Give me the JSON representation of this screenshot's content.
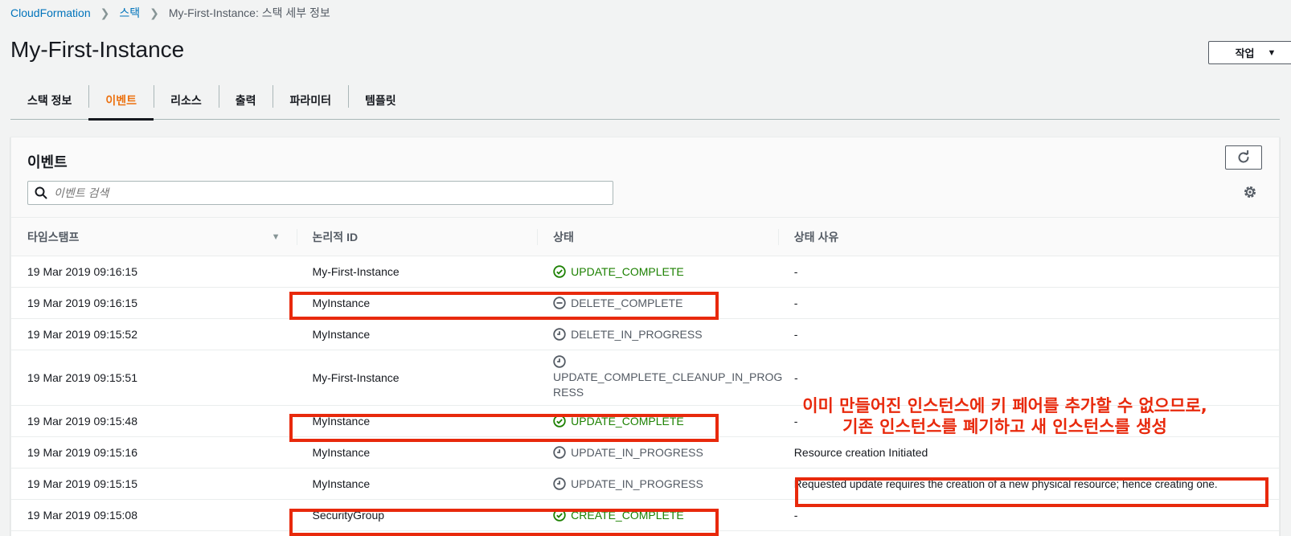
{
  "breadcrumb": {
    "items": [
      "CloudFormation",
      "스택"
    ],
    "current": "My-First-Instance: 스택 세부 정보"
  },
  "page_title": "My-First-Instance",
  "actions_label": "작업",
  "tabs": [
    {
      "label": "스택 정보"
    },
    {
      "label": "이벤트",
      "active": true
    },
    {
      "label": "리소스"
    },
    {
      "label": "출력"
    },
    {
      "label": "파라미터"
    },
    {
      "label": "템플릿"
    }
  ],
  "events": {
    "title": "이벤트",
    "search_placeholder": "이벤트 검색",
    "columns": [
      "타임스탬프",
      "논리적 ID",
      "상태",
      "상태 사유"
    ],
    "rows": [
      {
        "timestamp": "19 Mar 2019 09:16:15",
        "logical_id": "My-First-Instance",
        "status": "UPDATE_COMPLETE",
        "status_kind": "success",
        "reason": "-"
      },
      {
        "timestamp": "19 Mar 2019 09:16:15",
        "logical_id": "MyInstance",
        "status": "DELETE_COMPLETE",
        "status_kind": "deleted",
        "reason": "-"
      },
      {
        "timestamp": "19 Mar 2019 09:15:52",
        "logical_id": "MyInstance",
        "status": "DELETE_IN_PROGRESS",
        "status_kind": "progress",
        "reason": "-"
      },
      {
        "timestamp": "19 Mar 2019 09:15:51",
        "logical_id": "My-First-Instance",
        "status_lines": [
          "UPDATE_COMPLETE_CLEANUP_IN_PROG",
          "RESS"
        ],
        "status_kind": "progress",
        "reason": "-"
      },
      {
        "timestamp": "19 Mar 2019 09:15:48",
        "logical_id": "MyInstance",
        "status": "UPDATE_COMPLETE",
        "status_kind": "success",
        "reason": "-"
      },
      {
        "timestamp": "19 Mar 2019 09:15:16",
        "logical_id": "MyInstance",
        "status": "UPDATE_IN_PROGRESS",
        "status_kind": "progress",
        "reason": "Resource creation Initiated"
      },
      {
        "timestamp": "19 Mar 2019 09:15:15",
        "logical_id": "MyInstance",
        "status": "UPDATE_IN_PROGRESS",
        "status_kind": "progress",
        "reason": "Requested update requires the creation of a new physical resource; hence creating one."
      },
      {
        "timestamp": "19 Mar 2019 09:15:08",
        "logical_id": "SecurityGroup",
        "status": "CREATE_COMPLETE",
        "status_kind": "success",
        "reason": "-"
      }
    ]
  },
  "annotation": {
    "line1": "이미 만들어진 인스턴스에 키 페어를 추가할 수 없으므로,",
    "line2": "기존 인스턴스를 폐기하고 새 인스턴스를 생성"
  },
  "colors": {
    "link": "#0073bb",
    "active_tab": "#ec7211",
    "success": "#1d8102",
    "neutral": "#545b64",
    "highlight": "#e8290c"
  },
  "icons": {
    "success": "check-circle-icon",
    "deleted": "minus-circle-icon",
    "progress": "clock-icon",
    "refresh": "refresh-icon",
    "settings": "gear-icon",
    "search": "search-icon",
    "sort": "sort-down-icon"
  }
}
